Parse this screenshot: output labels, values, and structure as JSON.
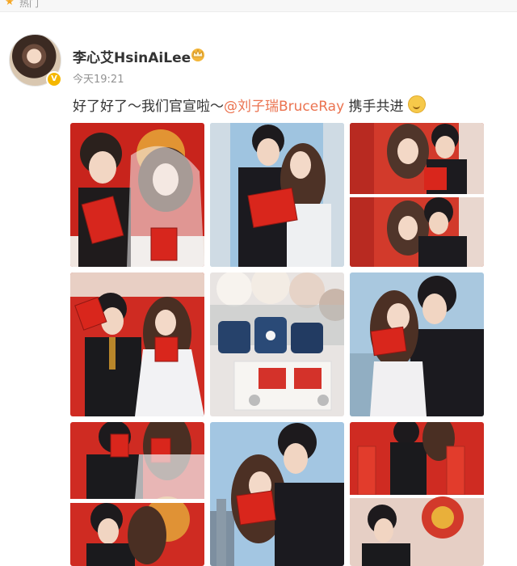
{
  "header": {
    "hot_label": "热门"
  },
  "post": {
    "username": "李心艾HsinAiLee",
    "time": "今天19:21",
    "text_prefix": "好了好了～我们官宣啦～",
    "mention": "@刘子瑞BruceRay",
    "text_suffix": " 携手共进"
  },
  "icons": {
    "verified": "verified-badge-icon",
    "crown": "crown-icon",
    "emoji": "smile-emoji-icon"
  },
  "colors": {
    "mention": "#eb7350",
    "time": "#939393",
    "accent_red": "#d9261c"
  },
  "photos": [
    {
      "scene": "red-background-couple-certificates"
    },
    {
      "scene": "city-window-couple-certificates"
    },
    {
      "scene": "red-room-couple-collage"
    },
    {
      "scene": "red-wall-couple-standing"
    },
    {
      "scene": "flowers-and-ring-box-with-certificates"
    },
    {
      "scene": "city-window-couple-embrace"
    },
    {
      "scene": "red-background-couple-hiding"
    },
    {
      "scene": "city-skyline-couple-certificates"
    },
    {
      "scene": "red-couplets-collage"
    }
  ]
}
